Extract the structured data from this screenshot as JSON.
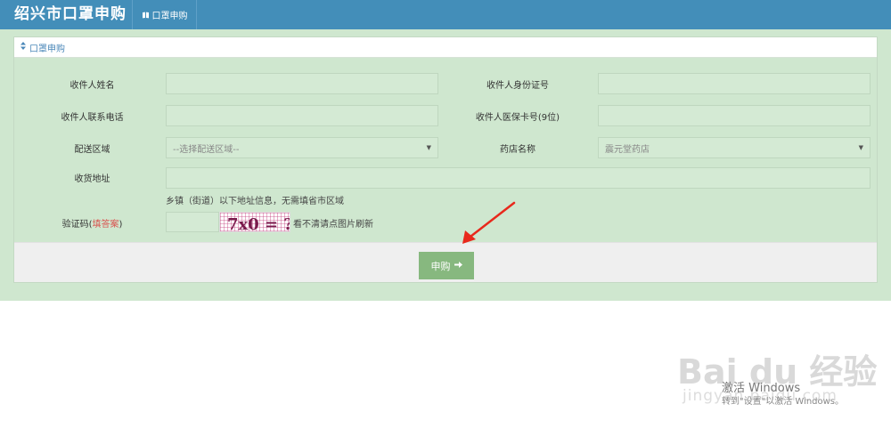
{
  "header": {
    "title": "绍兴市口罩申购",
    "tab_label": "口罩申购"
  },
  "panel": {
    "title": "口罩申购"
  },
  "form": {
    "name_label": "收件人姓名",
    "id_label": "收件人身份证号",
    "phone_label": "收件人联系电话",
    "insurance_label": "收件人医保卡号(9位)",
    "area_label": "配送区域",
    "area_value": "--选择配送区域--",
    "pharmacy_label": "药店名称",
    "pharmacy_value": "震元堂药店",
    "address_label": "收货地址",
    "address_hint": "乡镇（街道）以下地址信息，无需填省市区域",
    "captcha_label": "验证码(",
    "captcha_label_highlight": "填答案",
    "captcha_label_end": ")",
    "captcha_text": "7x0 = ?",
    "captcha_hint": "看不清请点图片刷新",
    "submit_label": "申购"
  },
  "watermark": {
    "logo_text": "Bai du 经验",
    "sub_text": "jingyan.baidu.com",
    "activate_text": "激活 Windows",
    "activate_hint": "转到\"设置\"以激活 Windows。"
  },
  "colors": {
    "header_bg": "#438eb9",
    "content_bg": "#cfe7cf",
    "submit_bg": "#87b87f",
    "arrow": "#e8291c"
  }
}
